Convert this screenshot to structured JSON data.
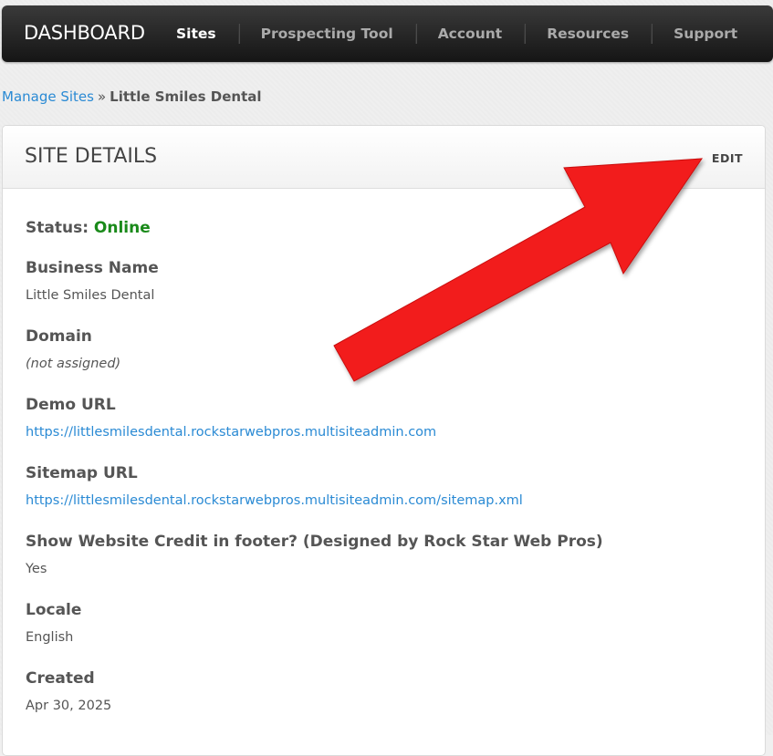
{
  "nav": {
    "brand": "DASHBOARD",
    "items": [
      {
        "label": "Sites",
        "active": true
      },
      {
        "label": "Prospecting Tool",
        "active": false
      },
      {
        "label": "Account",
        "active": false
      },
      {
        "label": "Resources",
        "active": false
      },
      {
        "label": "Support",
        "active": false
      }
    ]
  },
  "breadcrumb": {
    "parent": "Manage Sites",
    "separator": "»",
    "current": "Little Smiles Dental"
  },
  "panel": {
    "title": "SITE DETAILS",
    "edit_label": "EDIT",
    "status_label": "Status:",
    "status_value": "Online",
    "fields": [
      {
        "label": "Business Name",
        "value": "Little Smiles Dental"
      },
      {
        "label": "Domain",
        "value": "(not assigned)"
      },
      {
        "label": "Demo URL",
        "value": "https://littlesmilesdental.rockstarwebpros.multisiteadmin.com"
      },
      {
        "label": "Sitemap URL",
        "value": "https://littlesmilesdental.rockstarwebpros.multisiteadmin.com/sitemap.xml"
      },
      {
        "label": "Show Website Credit in footer? (Designed by Rock Star Web Pros)",
        "value": "Yes"
      },
      {
        "label": "Locale",
        "value": "English"
      },
      {
        "label": "Created",
        "value": "Apr 30, 2025"
      }
    ]
  },
  "colors": {
    "link": "#2a8ad4",
    "status_online": "#1a8a1a",
    "arrow": "#f21d1d"
  }
}
